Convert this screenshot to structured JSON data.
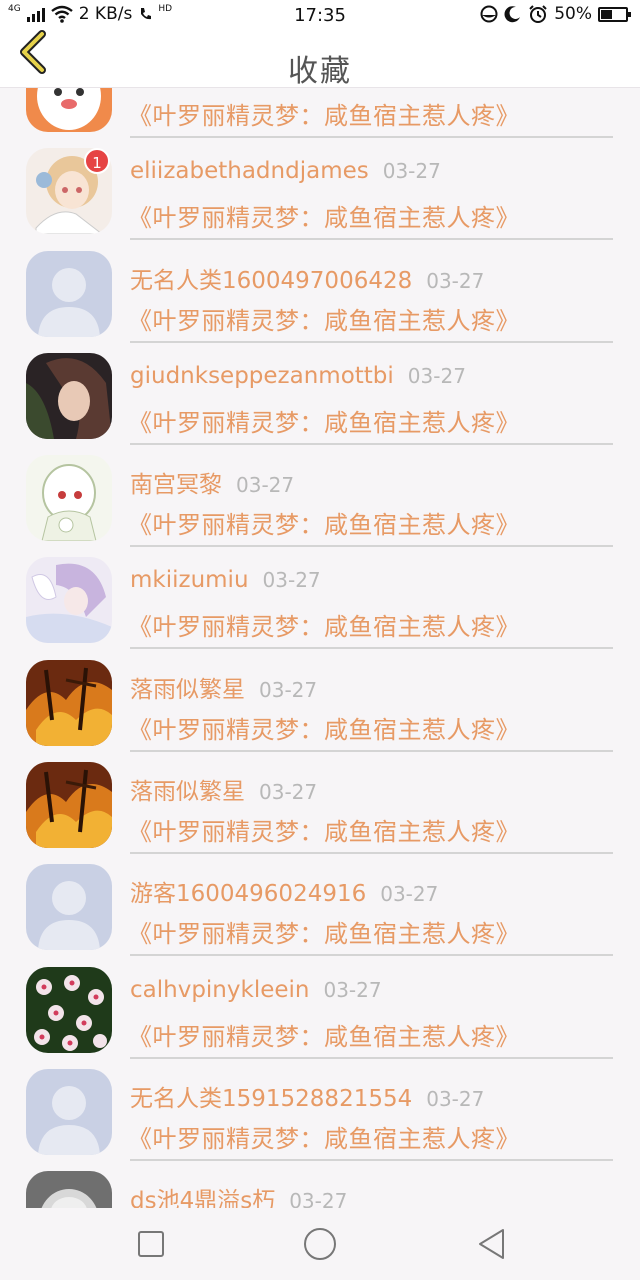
{
  "status": {
    "network": "4G",
    "speed": "2 KB/s",
    "call_tag": "HD",
    "time": "17:35",
    "battery": "50%",
    "battery_level": 0.5
  },
  "header": {
    "title": "收藏"
  },
  "items": [
    {
      "name": "",
      "date": "",
      "book": "《叶罗丽精灵梦：咸鱼宿主惹人疼》",
      "avatar": "dog-cartoon",
      "badge": ""
    },
    {
      "name": "eliizabethadndjames",
      "date": "03-27",
      "book": "《叶罗丽精灵梦：咸鱼宿主惹人疼》",
      "avatar": "anime-girl",
      "badge": "1"
    },
    {
      "name": "无名人类1600497006428",
      "date": "03-27",
      "book": "《叶罗丽精灵梦：咸鱼宿主惹人疼》",
      "avatar": "default",
      "badge": ""
    },
    {
      "name": "giudnkseppezanmottbi",
      "date": "03-27",
      "book": "《叶罗丽精灵梦：咸鱼宿主惹人疼》",
      "avatar": "photo-girl",
      "badge": ""
    },
    {
      "name": "南宫冥黎",
      "date": "03-27",
      "book": "《叶罗丽精灵梦：咸鱼宿主惹人疼》",
      "avatar": "sketch-girl",
      "badge": ""
    },
    {
      "name": "mkiizumiu",
      "date": "03-27",
      "book": "《叶罗丽精灵梦：咸鱼宿主惹人疼》",
      "avatar": "purple-anime",
      "badge": ""
    },
    {
      "name": "落雨似繁星",
      "date": "03-27",
      "book": "《叶罗丽精灵梦：咸鱼宿主惹人疼》",
      "avatar": "fire-scene",
      "badge": ""
    },
    {
      "name": "落雨似繁星",
      "date": "03-27",
      "book": "《叶罗丽精灵梦：咸鱼宿主惹人疼》",
      "avatar": "fire-scene",
      "badge": ""
    },
    {
      "name": "游客1600496024916",
      "date": "03-27",
      "book": "《叶罗丽精灵梦：咸鱼宿主惹人疼》",
      "avatar": "default",
      "badge": ""
    },
    {
      "name": "calhvpinykleein",
      "date": "03-27",
      "book": "《叶罗丽精灵梦：咸鱼宿主惹人疼》",
      "avatar": "flowers",
      "badge": ""
    },
    {
      "name": "无名人类1591528821554",
      "date": "03-27",
      "book": "《叶罗丽精灵梦：咸鱼宿主惹人疼》",
      "avatar": "default",
      "badge": ""
    },
    {
      "name": "ds池4鼎溢s朽",
      "date": "03-27",
      "book": "",
      "avatar": "grey-cat",
      "badge": ""
    }
  ],
  "colors": {
    "accent": "#e79a65",
    "date": "#b8b8b8",
    "divider": "#d4d4d4",
    "back_arrow": "#e6d24a"
  }
}
